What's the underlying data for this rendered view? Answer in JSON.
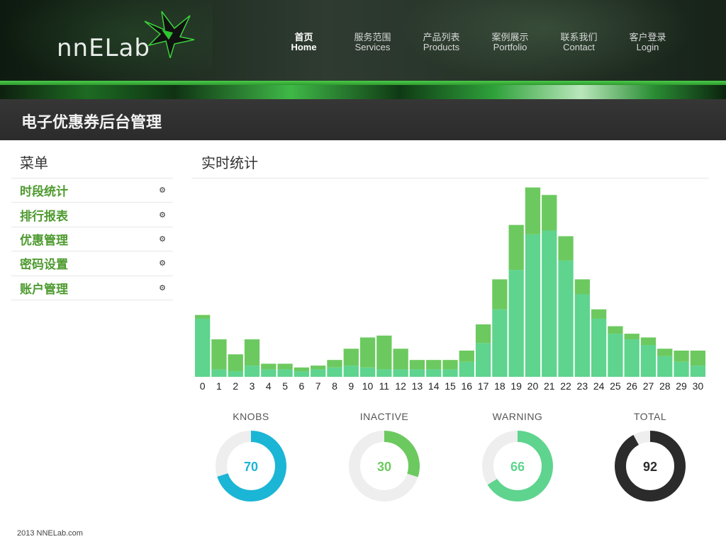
{
  "header": {
    "logo_text": "nnELab",
    "nav": [
      {
        "zh": "首页",
        "en": "Home",
        "active": true
      },
      {
        "zh": "服务范围",
        "en": "Services",
        "active": false
      },
      {
        "zh": "产品列表",
        "en": "Products",
        "active": false
      },
      {
        "zh": "案例展示",
        "en": "Portfolio",
        "active": false
      },
      {
        "zh": "联系我们",
        "en": "Contact",
        "active": false
      },
      {
        "zh": "客户登录",
        "en": "Login",
        "active": false
      }
    ]
  },
  "page_title": "电子优惠券后台管理",
  "sidebar": {
    "title": "菜单",
    "items": [
      {
        "label": "时段统计"
      },
      {
        "label": "排行报表"
      },
      {
        "label": "优惠管理"
      },
      {
        "label": "密码设置"
      },
      {
        "label": "账户管理"
      }
    ]
  },
  "main": {
    "title": "实时统计"
  },
  "colors": {
    "bar_top": "#6cc95f",
    "bar_bottom": "#5ed48e",
    "knobs": "#1bb5d6",
    "inactive": "#6cc95f",
    "warning": "#5ed48e",
    "total": "#2b2b2b",
    "track": "#eeeeee"
  },
  "chart_data": {
    "type": "bar",
    "stacked": true,
    "categories": [
      "0",
      "1",
      "2",
      "3",
      "4",
      "5",
      "6",
      "7",
      "8",
      "9",
      "10",
      "11",
      "12",
      "13",
      "14",
      "15",
      "16",
      "17",
      "18",
      "19",
      "20",
      "21",
      "22",
      "23",
      "24",
      "25",
      "26",
      "27",
      "28",
      "29",
      "30"
    ],
    "series": [
      {
        "values": [
          31,
          4,
          3,
          6,
          4,
          4,
          3,
          4,
          5,
          6,
          5,
          4,
          4,
          4,
          4,
          4,
          8,
          18,
          36,
          57,
          76,
          78,
          62,
          44,
          31,
          23,
          20,
          17,
          11,
          8,
          6
        ]
      },
      {
        "values": [
          2,
          16,
          9,
          14,
          3,
          3,
          2,
          2,
          4,
          9,
          16,
          18,
          11,
          5,
          5,
          5,
          6,
          10,
          16,
          24,
          25,
          19,
          13,
          8,
          5,
          4,
          3,
          4,
          4,
          6,
          8
        ]
      }
    ],
    "ylim": [
      0,
      102
    ]
  },
  "donuts": [
    {
      "label": "KNOBS",
      "value": 70
    },
    {
      "label": "INACTIVE",
      "value": 30
    },
    {
      "label": "WARNING",
      "value": 66
    },
    {
      "label": "TOTAL",
      "value": 92
    }
  ],
  "footer": {
    "text": "2013  NNELab.com"
  }
}
